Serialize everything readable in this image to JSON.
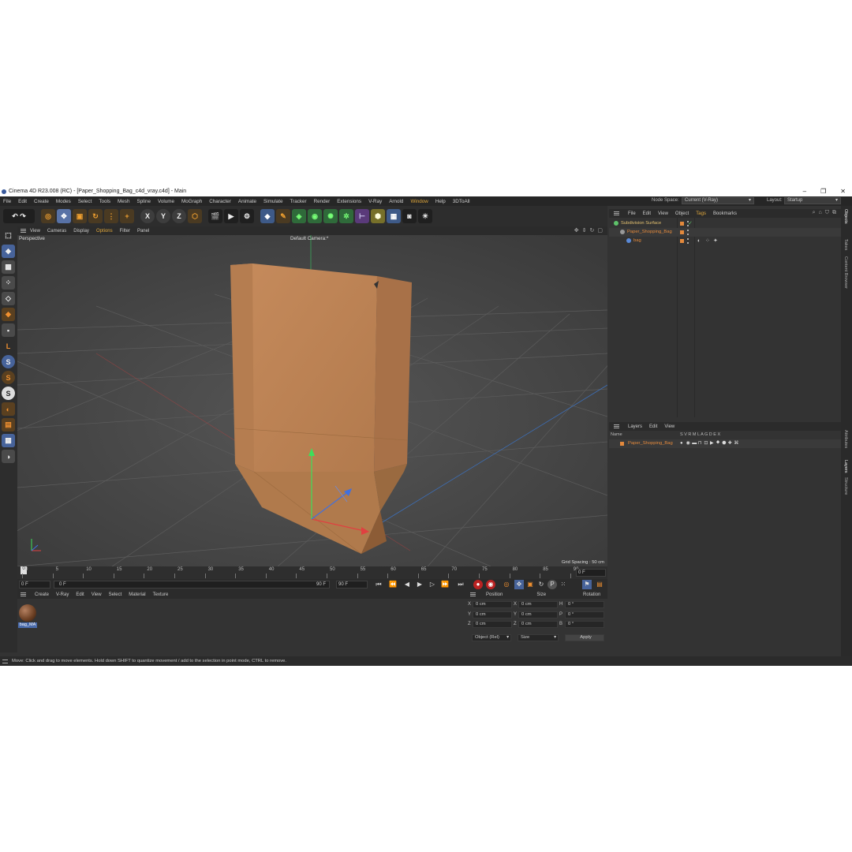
{
  "window": {
    "title": "Cinema 4D R23.008 (RC) - [Paper_Shopping_Bag_c4d_vray.c4d] - Main",
    "min": "–",
    "max": "❐",
    "close": "✕"
  },
  "menu": [
    "File",
    "Edit",
    "Create",
    "Modes",
    "Select",
    "Tools",
    "Mesh",
    "Spline",
    "Volume",
    "MoGraph",
    "Character",
    "Animate",
    "Simulate",
    "Tracker",
    "Render",
    "Extensions",
    "V-Ray",
    "Arnold",
    "Window",
    "Help",
    "3DToAll"
  ],
  "menu_highlight": [
    "Window"
  ],
  "nodespace": {
    "label": "Node Space:",
    "value": "Current (V-Ray)"
  },
  "layout": {
    "label": "Layout:",
    "value": "Startup"
  },
  "toolbar": {
    "x": "X",
    "y": "Y",
    "z": "Z"
  },
  "viewport_menu": [
    "View",
    "Cameras",
    "Display",
    "Options",
    "Filter",
    "Panel"
  ],
  "viewport_menu_highlight": [
    "Options"
  ],
  "viewport": {
    "name": "Perspective",
    "camera": "Default Camera:*",
    "grid_spacing": "Grid Spacing : 50 cm"
  },
  "timeline": {
    "ticks": [
      "0",
      "5",
      "10",
      "15",
      "20",
      "25",
      "30",
      "35",
      "40",
      "45",
      "50",
      "55",
      "60",
      "65",
      "70",
      "75",
      "80",
      "85",
      "90"
    ],
    "end_frame": "0 F"
  },
  "transport": {
    "start": "0 F",
    "current": "0 F",
    "end1": "90 F",
    "end2": "90 F"
  },
  "material_menu": [
    "Create",
    "V-Ray",
    "Edit",
    "View",
    "Select",
    "Material",
    "Texture"
  ],
  "material": {
    "name": "bag_MA"
  },
  "coords": {
    "headers": [
      "Position",
      "Size",
      "Rotation"
    ],
    "rows": [
      {
        "a": "X",
        "pos": "0 cm",
        "b": "X",
        "size": "0 cm",
        "c": "H",
        "rot": "0 °"
      },
      {
        "a": "Y",
        "pos": "0 cm",
        "b": "Y",
        "size": "0 cm",
        "c": "P",
        "rot": "0 °"
      },
      {
        "a": "Z",
        "pos": "0 cm",
        "b": "Z",
        "size": "0 cm",
        "c": "B",
        "rot": "0 °"
      }
    ],
    "mode": "Object (Rel)",
    "size_mode": "Size",
    "apply": "Apply"
  },
  "object_menu": [
    "File",
    "Edit",
    "View",
    "Object",
    "Tags",
    "Bookmarks"
  ],
  "object_menu_highlight": [
    "Tags"
  ],
  "objects": [
    {
      "name": "Subdivision Surface",
      "color": "#e3c070"
    },
    {
      "name": "Paper_Shopping_Bag",
      "color": "#e3893c"
    },
    {
      "name": "bag",
      "color": "#e3893c"
    }
  ],
  "layer_menu": [
    "Layers",
    "Edit",
    "View"
  ],
  "layer_header": {
    "name": "Name",
    "cols": "S  V  R  M  L  A  G  D  E  X"
  },
  "layers": [
    {
      "name": "Paper_Shopping_Bag",
      "color": "#e3893c"
    }
  ],
  "sidetabs": [
    "Objects",
    "Takes",
    "Content Browser",
    "Attributes",
    "Layers",
    "Structure"
  ],
  "status": "Move: Click and drag to move elements. Hold down SHIFT to quantize movement / add to the selection in point mode, CTRL to remove."
}
